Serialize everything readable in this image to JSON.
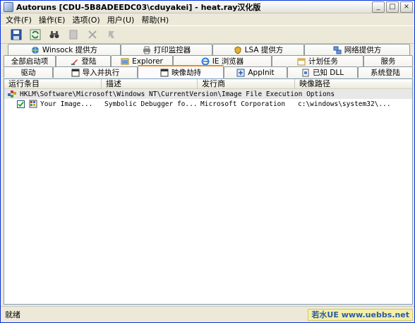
{
  "window": {
    "title": "Autoruns [CDU-5B8ADEEDC03\\cduyakei] - heat.ray汉化版",
    "controls": {
      "minimize": "_",
      "maximize": "□",
      "close": "×"
    }
  },
  "menu": {
    "items": [
      "文件(F)",
      "操作(E)",
      "选项(O)",
      "用户(U)",
      "帮助(H)"
    ]
  },
  "toolbar": {
    "buttons": [
      "save-icon",
      "refresh-icon",
      "find-icon",
      "copy-icon",
      "delete-icon",
      "jump-icon"
    ]
  },
  "tabs": {
    "row1": [
      "Winsock 提供方",
      "打印监控器",
      "LSA 提供方",
      "网络提供方"
    ],
    "row2": [
      "全部启动项",
      "登陆",
      "Explorer",
      "IE 浏览器",
      "计划任务",
      "服务"
    ],
    "row3": [
      "驱动",
      "导入并执行",
      "映像劫持",
      "AppInit",
      "已知 DLL",
      "系统登陆"
    ],
    "selected": "映像劫持"
  },
  "list": {
    "columns": [
      "运行条目",
      "描述",
      "发行商",
      "映像路径"
    ],
    "group_row": "HKLM\\Software\\Microsoft\\Windows NT\\CurrentVersion\\Image File Execution Options",
    "entries": [
      {
        "checked": true,
        "entry": "Your Image...",
        "description": "Symbolic Debugger fo...",
        "publisher": "Microsoft Corporation",
        "path": "c:\\windows\\system32\\..."
      }
    ]
  },
  "status": {
    "text": "就绪",
    "watermark": "若水UE www.uebbs.net"
  },
  "colors": {
    "window_border": "#0831d9",
    "selected_tab_accent": "#e68b2c",
    "group_row_bg": "#e8e8e8",
    "watermark_bg": "#f5f0a8"
  }
}
